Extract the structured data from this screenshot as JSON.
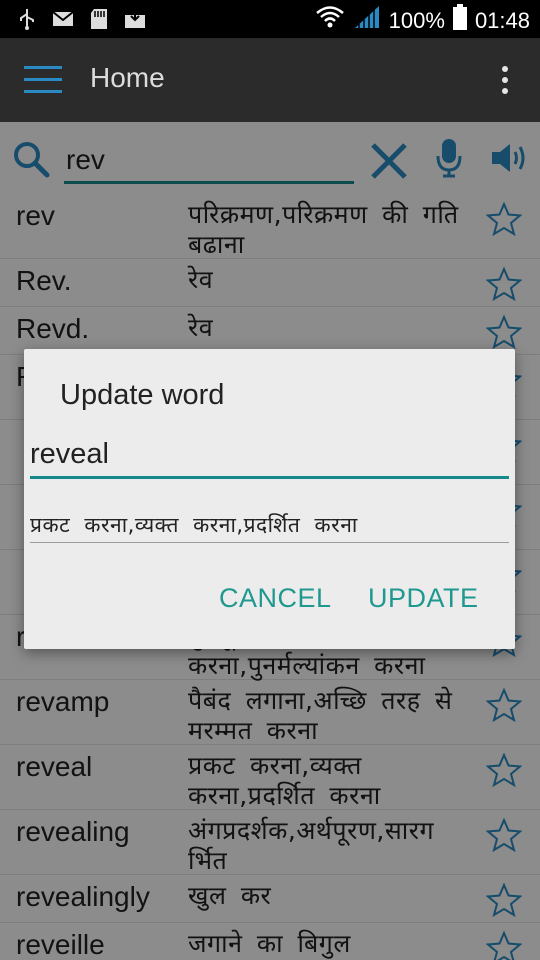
{
  "status_bar": {
    "left_icons": [
      "usb-icon",
      "email-icon",
      "sd-card-icon",
      "download-icon"
    ],
    "battery": "100%",
    "time": "01:48"
  },
  "app_bar": {
    "title": "Home"
  },
  "search": {
    "value": "rev"
  },
  "results": [
    {
      "word": "rev",
      "meaning": "परिक्रमण,परिक्रमण की गति बढाना",
      "starred": false
    },
    {
      "word": "Rev.",
      "meaning": "रेव",
      "starred": false
    },
    {
      "word": "Revd.",
      "meaning": "रेव",
      "starred": false
    },
    {
      "word": "R",
      "meaning": "",
      "starred": false
    },
    {
      "word": "",
      "meaning": "",
      "starred": false
    },
    {
      "word": "",
      "meaning": "",
      "starred": false
    },
    {
      "word": "",
      "meaning": "",
      "starred": false
    },
    {
      "word": "revalue",
      "meaning": "पुनर्मूल्यांकन करना,पुनर्मल्यांकन करना",
      "starred": false
    },
    {
      "word": "revamp",
      "meaning": "पैबंद लगाना,अच्छि तरह से मरम्मत करना",
      "starred": false
    },
    {
      "word": "reveal",
      "meaning": "प्रकट करना,व्यक्त करना,प्रदर्शित करना",
      "starred": false
    },
    {
      "word": "revealing",
      "meaning": "अंगप्रदर्शक,अर्थपूरण,सारग र्भित",
      "starred": false
    },
    {
      "word": "revealingly",
      "meaning": "खुल कर",
      "starred": false
    },
    {
      "word": "reveille",
      "meaning": "जगाने का बिगुल",
      "starred": false
    }
  ],
  "dialog": {
    "title": "Update word",
    "word_value": "reveal",
    "meaning_value": "प्रकट करना,व्यक्त करना,प्रदर्शित करना",
    "cancel_label": "CANCEL",
    "update_label": "UPDATE"
  },
  "colors": {
    "accent": "#168a8a",
    "button_text": "#1f9990",
    "icon_blue": "#2a8bc4",
    "app_bar": "#2b2b2b"
  }
}
